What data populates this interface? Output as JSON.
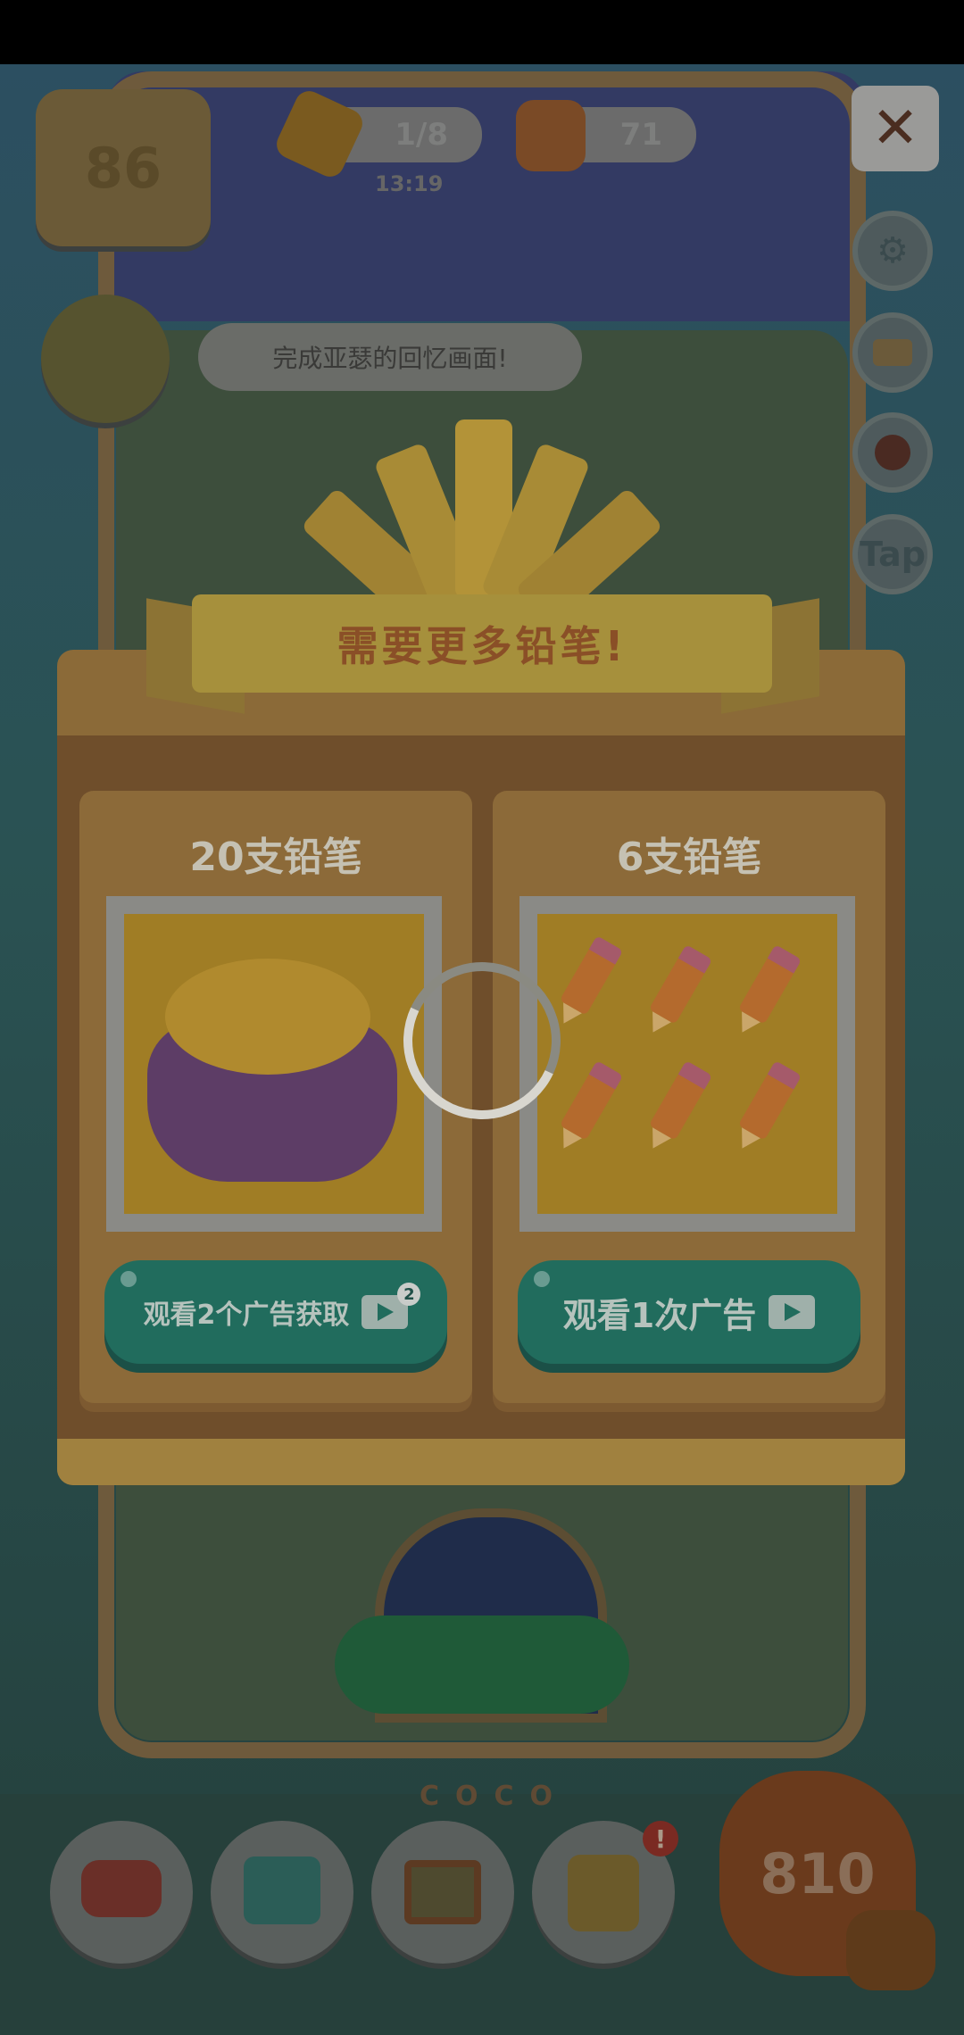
{
  "hud": {
    "house_level": "86",
    "pencil_count": "1/8",
    "timer": "13:19",
    "coins": "71",
    "close_label": "✕",
    "tap_label": "Tap",
    "task_text": "完成亚瑟的回忆画面!"
  },
  "scene": {
    "sign_text": "COCO"
  },
  "popup": {
    "title": "需要更多铅笔!",
    "options": [
      {
        "title": "20支铅笔",
        "button_label": "观看2个广告获取",
        "badge": "2"
      },
      {
        "title": "6支铅笔",
        "button_label": "观看1次广告"
      }
    ]
  },
  "bottom_bar": {
    "score": "810"
  }
}
